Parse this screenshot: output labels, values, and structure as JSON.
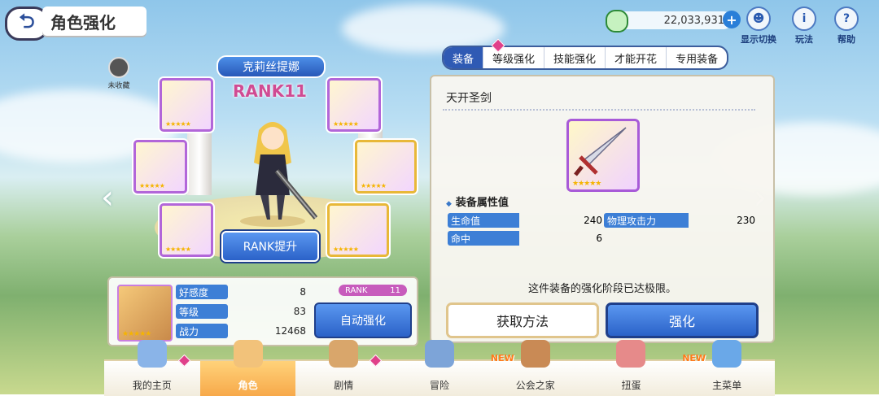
{
  "header": {
    "back_label": "⮌",
    "title": "角色强化"
  },
  "currency": {
    "gold": "22,033,931",
    "plus": "+"
  },
  "top_icons": [
    {
      "label": "显示切换",
      "icon": "toggle-display-icon",
      "glyph": "☻"
    },
    {
      "label": "玩法",
      "icon": "info-icon",
      "glyph": "i"
    },
    {
      "label": "帮助",
      "icon": "help-icon",
      "glyph": "?"
    }
  ],
  "favorite": {
    "label": "未收藏"
  },
  "character": {
    "name": "克莉丝提娜",
    "rank_text": "RANK11",
    "rankup_label": "RANK提升"
  },
  "tabs": [
    "装备",
    "等级强化",
    "技能强化",
    "才能开花",
    "专用装备"
  ],
  "equipment": {
    "name": "天开圣剑",
    "stats_title": "装备属性值",
    "stats": [
      {
        "label": "生命值",
        "value": "240"
      },
      {
        "label": "物理攻击力",
        "value": "230"
      },
      {
        "label": "命中",
        "value": "6"
      }
    ],
    "note": "这件装备的强化阶段已达极限。",
    "acquire_label": "获取方法",
    "enhance_label": "强化"
  },
  "info": {
    "rows": [
      {
        "label": "好感度",
        "value": "8"
      },
      {
        "label": "等级",
        "value": "83"
      },
      {
        "label": "战力",
        "value": "12468"
      }
    ],
    "rank_label": "RANK",
    "rank_value": "11",
    "auto_label": "自动强化"
  },
  "nav": [
    {
      "label": "我的主页",
      "new": "",
      "gem": true
    },
    {
      "label": "角色",
      "new": "",
      "gem": false
    },
    {
      "label": "剧情",
      "new": "",
      "gem": true
    },
    {
      "label": "冒险",
      "new": "",
      "gem": false
    },
    {
      "label": "公会之家",
      "new": "NEW",
      "gem": false
    },
    {
      "label": "扭蛋",
      "new": "",
      "gem": false
    },
    {
      "label": "主菜单",
      "new": "NEW",
      "gem": false
    }
  ],
  "stars": "★★★★★",
  "colors": {
    "accent_blue": "#2f5ab4",
    "rank_pink": "#d04b93",
    "gem_pink": "#e0408a"
  }
}
